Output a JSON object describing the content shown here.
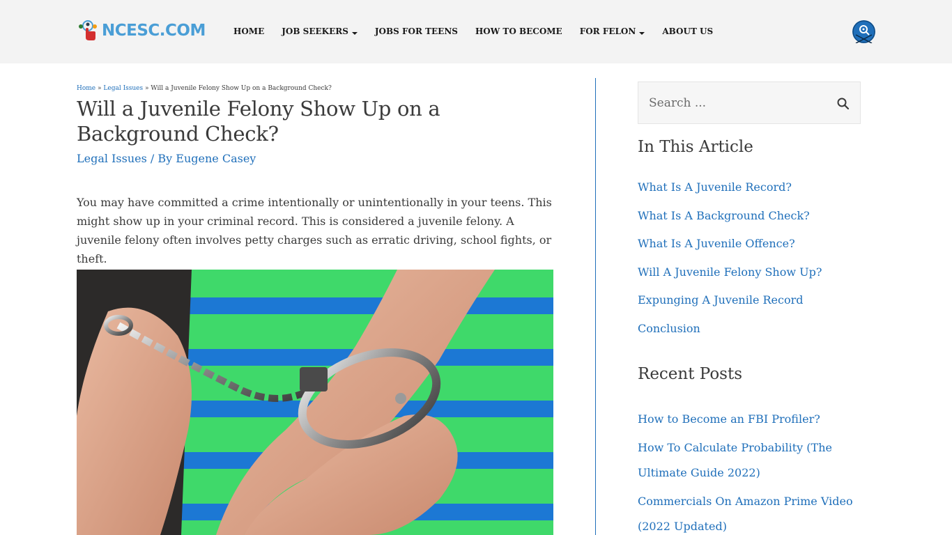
{
  "header": {
    "logo_text": "NCESC.COM",
    "nav": [
      {
        "label": "HOME",
        "has_dropdown": false
      },
      {
        "label": "JOB SEEKERS",
        "has_dropdown": true
      },
      {
        "label": "JOBS FOR TEENS",
        "has_dropdown": false
      },
      {
        "label": "HOW TO BECOME",
        "has_dropdown": false
      },
      {
        "label": "FOR FELON",
        "has_dropdown": true
      },
      {
        "label": "ABOUT US",
        "has_dropdown": false
      }
    ],
    "action_icon": "search-user-icon"
  },
  "breadcrumb": {
    "home": "Home",
    "separator1": "»",
    "category": "Legal Issues",
    "separator2": "»",
    "current": "Will a Juvenile Felony Show Up on a Background Check?"
  },
  "post": {
    "title": "Will a Juvenile Felony Show Up on a Background Check?",
    "category": "Legal Issues",
    "meta_separator": " / By ",
    "author": "Eugene Casey",
    "intro": "You may have committed a crime intentionally or unintentionally in your teens. This might show up in your criminal record. This is considered a juvenile felony. A juvenile felony often involves petty charges such as erratic driving, school fights, or theft.",
    "image": "handcuffed-wrists-photo"
  },
  "sidebar": {
    "search_placeholder": "Search ...",
    "toc_title": "In This Article",
    "toc": [
      "What Is A Juvenile Record?",
      "What Is A Background Check?",
      "What Is A Juvenile Offence?",
      "Will A Juvenile Felony Show Up?",
      "Expunging A Juvenile Record",
      "Conclusion"
    ],
    "recent_title": "Recent Posts",
    "recent": [
      "How to Become an FBI Profiler?",
      "How To Calculate Probability (The Ultimate Guide 2022)",
      "Commercials On Amazon Prime Video (2022 Updated)"
    ]
  },
  "colors": {
    "accent": "#1f6fba",
    "logo": "#4a9ed6",
    "header_bg": "#f3f3f3",
    "text": "#3a3a3a"
  }
}
